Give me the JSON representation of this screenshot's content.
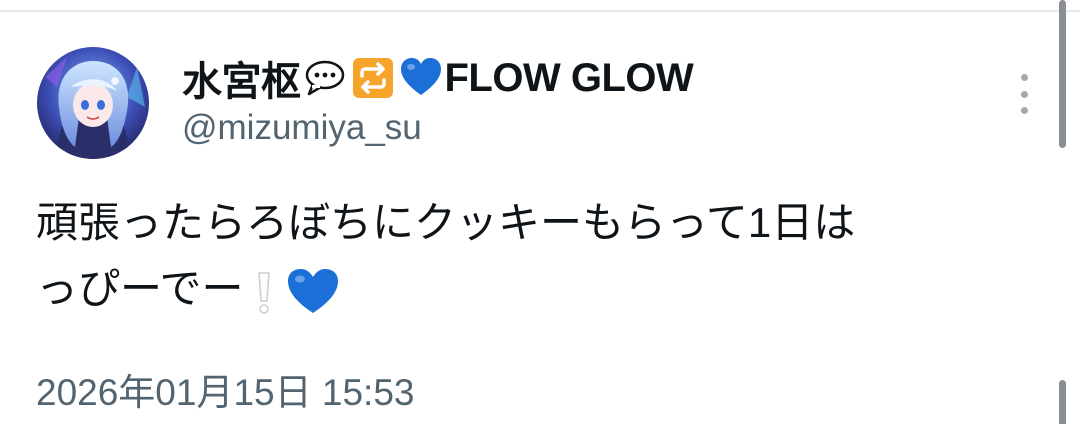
{
  "tweet": {
    "author": {
      "display_name_prefix": "水宮枢",
      "display_name_emojis": [
        "speech-bubble-icon",
        "repeat-icon",
        "blue-heart-icon"
      ],
      "display_name_suffix": "FLOW GLOW",
      "handle": "@mizumiya_su"
    },
    "text_line_1": "頑張ったらろぼちにクッキーもらって1日は",
    "text_line_2": "っぴーでー",
    "text_emojis": [
      "exclamation-icon",
      "blue-heart-icon"
    ],
    "timestamp": "2026年01月15日 15:53"
  },
  "colors": {
    "primary_text": "#0f1419",
    "secondary_text": "#536471",
    "blue_heart": "#1d6fd8",
    "divider": "#e6e9ec",
    "scrollbar": "#8a8f94"
  }
}
